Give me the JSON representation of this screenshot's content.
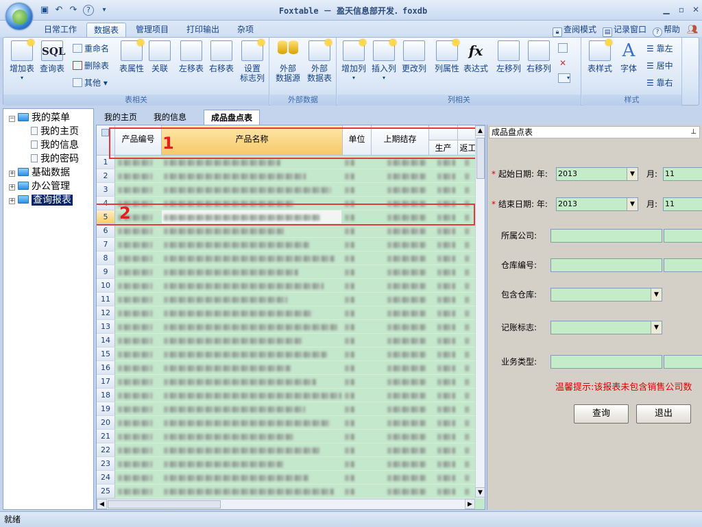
{
  "window": {
    "title": "Foxtable － 盈天信息部开发．foxdb"
  },
  "menu": {
    "tabs": [
      "日常工作",
      "数据表",
      "管理项目",
      "打印输出",
      "杂项"
    ],
    "active": 1,
    "right": {
      "view_mode": "查阅模式",
      "record_window": "记录窗口",
      "help": "帮助"
    }
  },
  "ribbon": {
    "groups": [
      "表相关",
      "外部数据",
      "列相关",
      "样式"
    ],
    "table": {
      "add": "增加表",
      "query": "查询表",
      "rename": "重命名",
      "delete": "删除表",
      "other": "其他",
      "props": "表属性",
      "relate": "关联",
      "move_left": "左移表",
      "move_right": "右移表",
      "flag_l1": "设置",
      "flag_l2": "标志列",
      "sql_glyph": "SQL"
    },
    "external": {
      "src_l1": "外部",
      "src_l2": "数据源",
      "tbl_l1": "外部",
      "tbl_l2": "数据表"
    },
    "column": {
      "add": "增加列",
      "insert": "插入列",
      "change": "更改列",
      "props": "列属性",
      "expr": "表达式",
      "left": "左移列",
      "right": "右移列",
      "fx_glyph": "fx"
    },
    "style": {
      "table_style": "表样式",
      "font": "字体",
      "left": "靠左",
      "center": "居中",
      "right": "靠右",
      "font_glyph": "A"
    }
  },
  "tree": {
    "root": "我的菜单",
    "children": [
      "我的主页",
      "我的信息",
      "我的密码"
    ],
    "groups": [
      "基础数据",
      "办公管理",
      "查询报表"
    ]
  },
  "doc_tabs": [
    "我的主页",
    "我的信息",
    "成品盘点表"
  ],
  "grid": {
    "headers": {
      "code": "产品编号",
      "name": "产品名称",
      "unit": "单位",
      "prev": "上期结存",
      "prod": "生产",
      "ret": "返工"
    },
    "rows": [
      "1",
      "2",
      "3",
      "4",
      "5",
      "6",
      "7",
      "8",
      "9",
      "10",
      "11",
      "12",
      "13",
      "14",
      "15",
      "16",
      "17",
      "18",
      "19",
      "20",
      "21",
      "22",
      "23",
      "24",
      "25"
    ],
    "current_row": 5,
    "annotations": [
      "1",
      "2"
    ]
  },
  "panel": {
    "title": "成品盘点表",
    "start_date": {
      "label": "起始日期:",
      "year_label": "年:",
      "year": "2013",
      "month_label": "月:",
      "month": "11"
    },
    "end_date": {
      "label": "结束日期:",
      "year_label": "年:",
      "year": "2013",
      "month_label": "月:",
      "month": "11"
    },
    "company_label": "所属公司:",
    "warehouse_label": "仓库编号:",
    "include_label": "包含仓库:",
    "flag_label": "记账标志:",
    "biz_label": "业务类型:",
    "hint": "温馨提示:该报表未包含销售公司数",
    "query_btn": "查询",
    "exit_btn": "退出"
  },
  "status": "就绪",
  "colors": {
    "grid_bg": "#c4e8cc",
    "highlight": "#f7c86a",
    "annotation": "#e03a3a"
  }
}
